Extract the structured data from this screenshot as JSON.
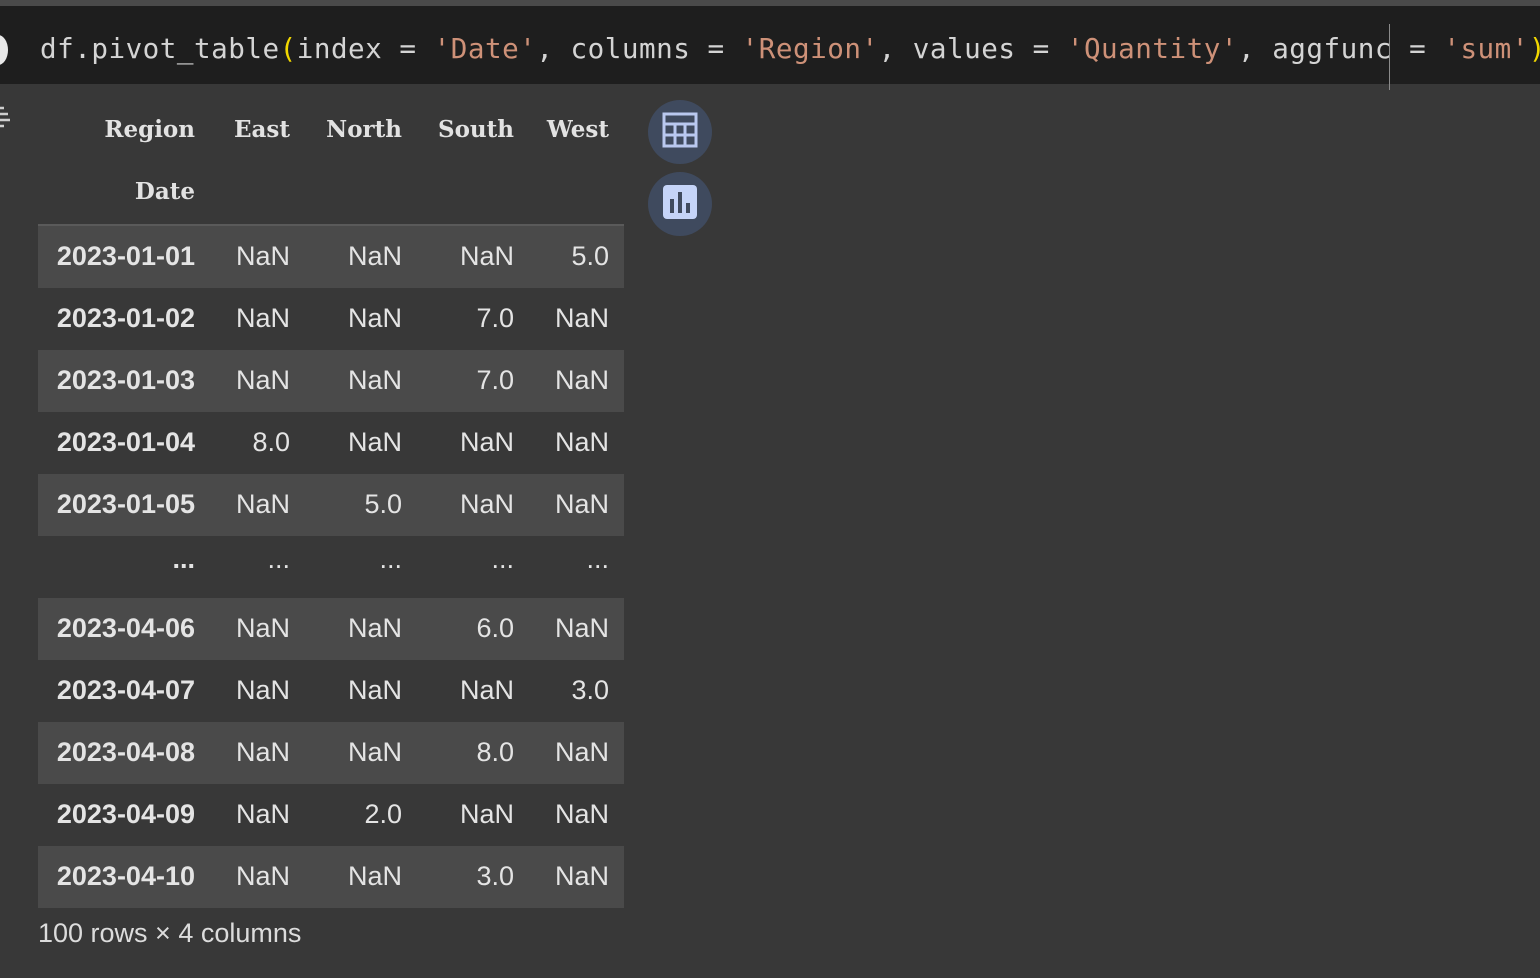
{
  "code": {
    "tok1": "df.pivot_table",
    "tok2": "(",
    "tok3": "index = ",
    "tok4": "'Date'",
    "tok5": ", columns = ",
    "tok6": "'Region'",
    "tok7": ", values = ",
    "tok8": "'Quantity'",
    "tok9": ", aggfunc = ",
    "tok10": "'sum'",
    "tok11": ")"
  },
  "table": {
    "columns_name": "Region",
    "index_name": "Date",
    "columns": [
      "East",
      "North",
      "South",
      "West"
    ],
    "rows": [
      {
        "index": "2023-01-01",
        "values": [
          "NaN",
          "NaN",
          "NaN",
          "5.0"
        ]
      },
      {
        "index": "2023-01-02",
        "values": [
          "NaN",
          "NaN",
          "7.0",
          "NaN"
        ]
      },
      {
        "index": "2023-01-03",
        "values": [
          "NaN",
          "NaN",
          "7.0",
          "NaN"
        ]
      },
      {
        "index": "2023-01-04",
        "values": [
          "8.0",
          "NaN",
          "NaN",
          "NaN"
        ]
      },
      {
        "index": "2023-01-05",
        "values": [
          "NaN",
          "5.0",
          "NaN",
          "NaN"
        ]
      },
      {
        "index": "...",
        "values": [
          "...",
          "...",
          "...",
          "..."
        ]
      },
      {
        "index": "2023-04-06",
        "values": [
          "NaN",
          "NaN",
          "6.0",
          "NaN"
        ]
      },
      {
        "index": "2023-04-07",
        "values": [
          "NaN",
          "NaN",
          "NaN",
          "3.0"
        ]
      },
      {
        "index": "2023-04-08",
        "values": [
          "NaN",
          "NaN",
          "8.0",
          "NaN"
        ]
      },
      {
        "index": "2023-04-09",
        "values": [
          "NaN",
          "2.0",
          "NaN",
          "NaN"
        ]
      },
      {
        "index": "2023-04-10",
        "values": [
          "NaN",
          "NaN",
          "3.0",
          "NaN"
        ]
      }
    ],
    "shape": "100 rows × 4 columns"
  },
  "icons": {
    "run": "run-cell-icon",
    "output_action": "output-action-icon",
    "table_view": "table-icon",
    "chart_view": "bar-chart-icon"
  },
  "colors": {
    "background": "#383838",
    "code_background": "#1e1e1e",
    "string": "#ce9178",
    "stripe": "#4a4a4a",
    "button": "#3f4a5e"
  }
}
